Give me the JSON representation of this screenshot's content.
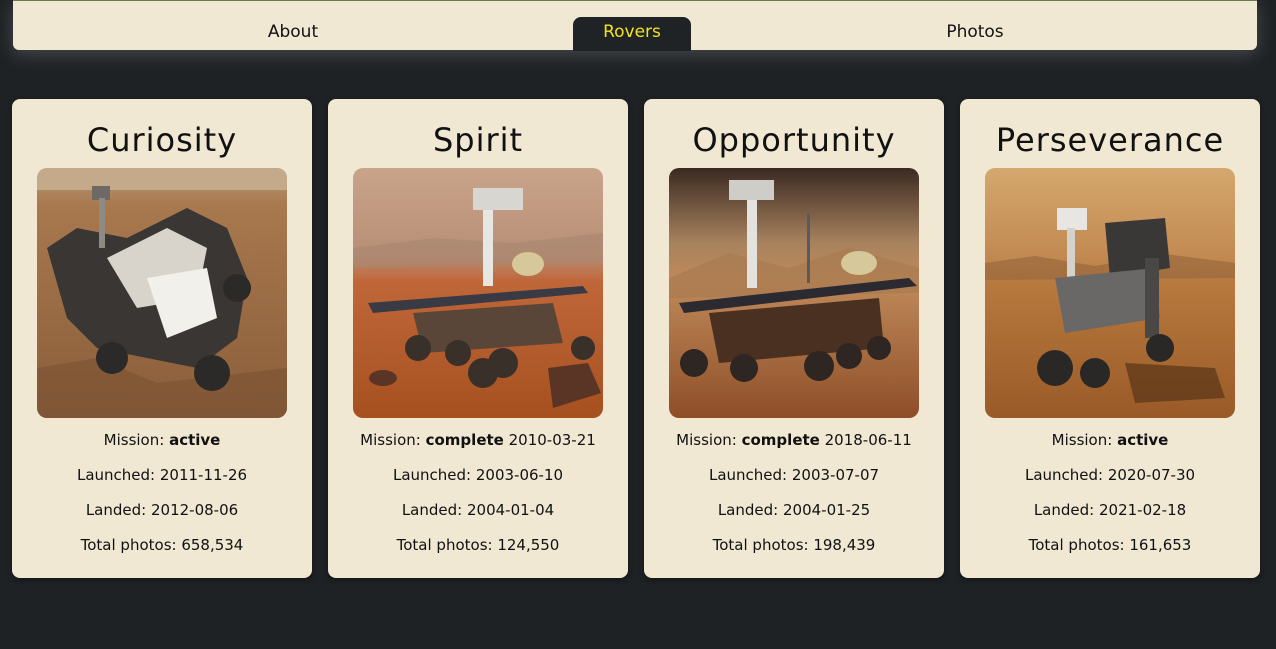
{
  "nav": {
    "tabs": [
      {
        "label": "About"
      },
      {
        "label": "Rovers"
      },
      {
        "label": "Photos"
      }
    ],
    "active": "Rovers"
  },
  "rovers": [
    {
      "name": "Curiosity",
      "mission_label": "Mission:",
      "status": "active",
      "end_date": "",
      "launched": "Launched: 2011-11-26",
      "landed": "Landed: 2012-08-06",
      "photos": "Total photos: 658,534"
    },
    {
      "name": "Spirit",
      "mission_label": "Mission:",
      "status": "complete",
      "end_date": "2010-03-21",
      "launched": "Launched: 2003-06-10",
      "landed": "Landed: 2004-01-04",
      "photos": "Total photos: 124,550"
    },
    {
      "name": "Opportunity",
      "mission_label": "Mission:",
      "status": "complete",
      "end_date": "2018-06-11",
      "launched": "Launched: 2003-07-07",
      "landed": "Landed: 2004-01-25",
      "photos": "Total photos: 198,439"
    },
    {
      "name": "Perseverance",
      "mission_label": "Mission:",
      "status": "active",
      "end_date": "",
      "launched": "Launched: 2020-07-30",
      "landed": "Landed: 2021-02-18",
      "photos": "Total photos: 161,653"
    }
  ],
  "colors": {
    "page_bg": "#1e2225",
    "card_bg": "#f1e8d4",
    "active_tab_text": "#f2e31d"
  }
}
